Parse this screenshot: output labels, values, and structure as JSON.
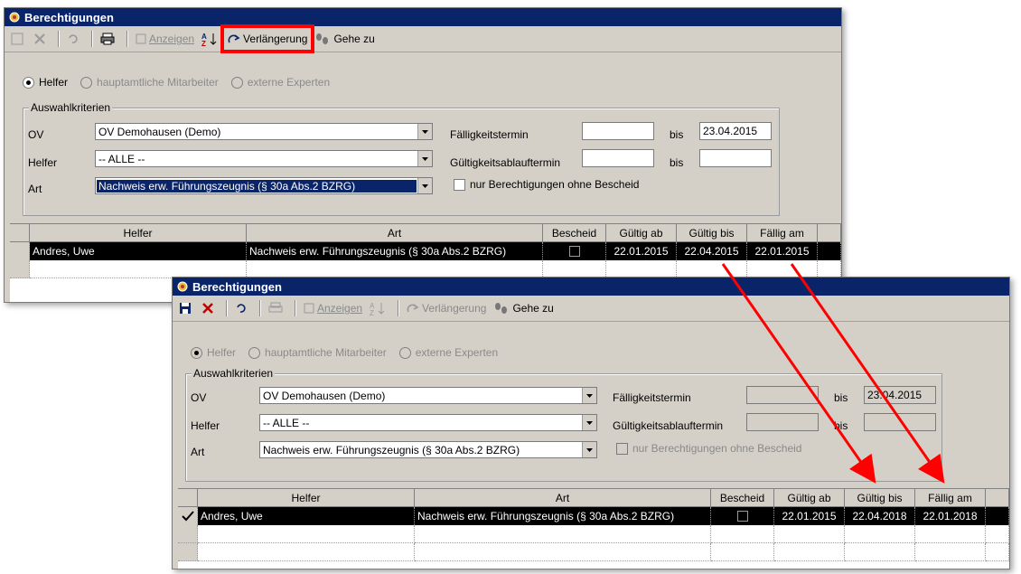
{
  "window1": {
    "title": "Berechtigungen",
    "toolbar": {
      "anzeigen": "Anzeigen",
      "verlaengerung": "Verlängerung",
      "gehe_zu": "Gehe zu"
    },
    "radios": {
      "helfer": "Helfer",
      "hauptamtliche": "hauptamtliche Mitarbeiter",
      "externe": "externe Experten"
    },
    "group_title": "Auswahlkriterien",
    "labels": {
      "ov": "OV",
      "helfer": "Helfer",
      "art": "Art"
    },
    "combos": {
      "ov": "OV Demohausen (Demo)",
      "helfer": "-- ALLE --",
      "art": "Nachweis erw. Führungszeugnis (§ 30a Abs.2 BZRG)"
    },
    "right": {
      "faelligkeit_label": "Fälligkeitstermin",
      "gueltigkeit_label": "Gültigkeitsablauftermin",
      "bis": "bis",
      "faelligkeit_bis": "23.04.2015",
      "gueltigkeit_bis": "",
      "checkbox_label": "nur Berechtigungen ohne Bescheid"
    },
    "table": {
      "headers": [
        "Helfer",
        "Art",
        "Bescheid",
        "Gültig ab",
        "Gültig bis",
        "Fällig am"
      ],
      "row": {
        "helfer": "Andres, Uwe",
        "art": "Nachweis erw. Führungszeugnis (§ 30a Abs.2 BZRG)",
        "gueltig_ab": "22.01.2015",
        "gueltig_bis": "22.04.2015",
        "faellig_am": "22.01.2015"
      }
    }
  },
  "window2": {
    "title": "Berechtigungen",
    "toolbar": {
      "anzeigen": "Anzeigen",
      "verlaengerung": "Verlängerung",
      "gehe_zu": "Gehe zu"
    },
    "radios": {
      "helfer": "Helfer",
      "hauptamtliche": "hauptamtliche Mitarbeiter",
      "externe": "externe Experten"
    },
    "group_title": "Auswahlkriterien",
    "labels": {
      "ov": "OV",
      "helfer": "Helfer",
      "art": "Art"
    },
    "combos": {
      "ov": "OV Demohausen (Demo)",
      "helfer": "-- ALLE --",
      "art": "Nachweis erw. Führungszeugnis (§ 30a Abs.2 BZRG)"
    },
    "right": {
      "faelligkeit_label": "Fälligkeitstermin",
      "gueltigkeit_label": "Gültigkeitsablauftermin",
      "bis": "bis",
      "faelligkeit_bis": "23.04.2015",
      "gueltigkeit_bis": "",
      "checkbox_label": "nur Berechtigungen ohne Bescheid"
    },
    "table": {
      "headers": [
        "Helfer",
        "Art",
        "Bescheid",
        "Gültig ab",
        "Gültig bis",
        "Fällig am"
      ],
      "row": {
        "helfer": "Andres, Uwe",
        "art": "Nachweis erw. Führungszeugnis (§ 30a Abs.2 BZRG)",
        "gueltig_ab": "22.01.2015",
        "gueltig_bis": "22.04.2018",
        "faellig_am": "22.01.2018"
      }
    }
  },
  "colors": {
    "titlebar": "#0a246a",
    "highlight": "#ff0000",
    "window": "#d4d0c8"
  }
}
